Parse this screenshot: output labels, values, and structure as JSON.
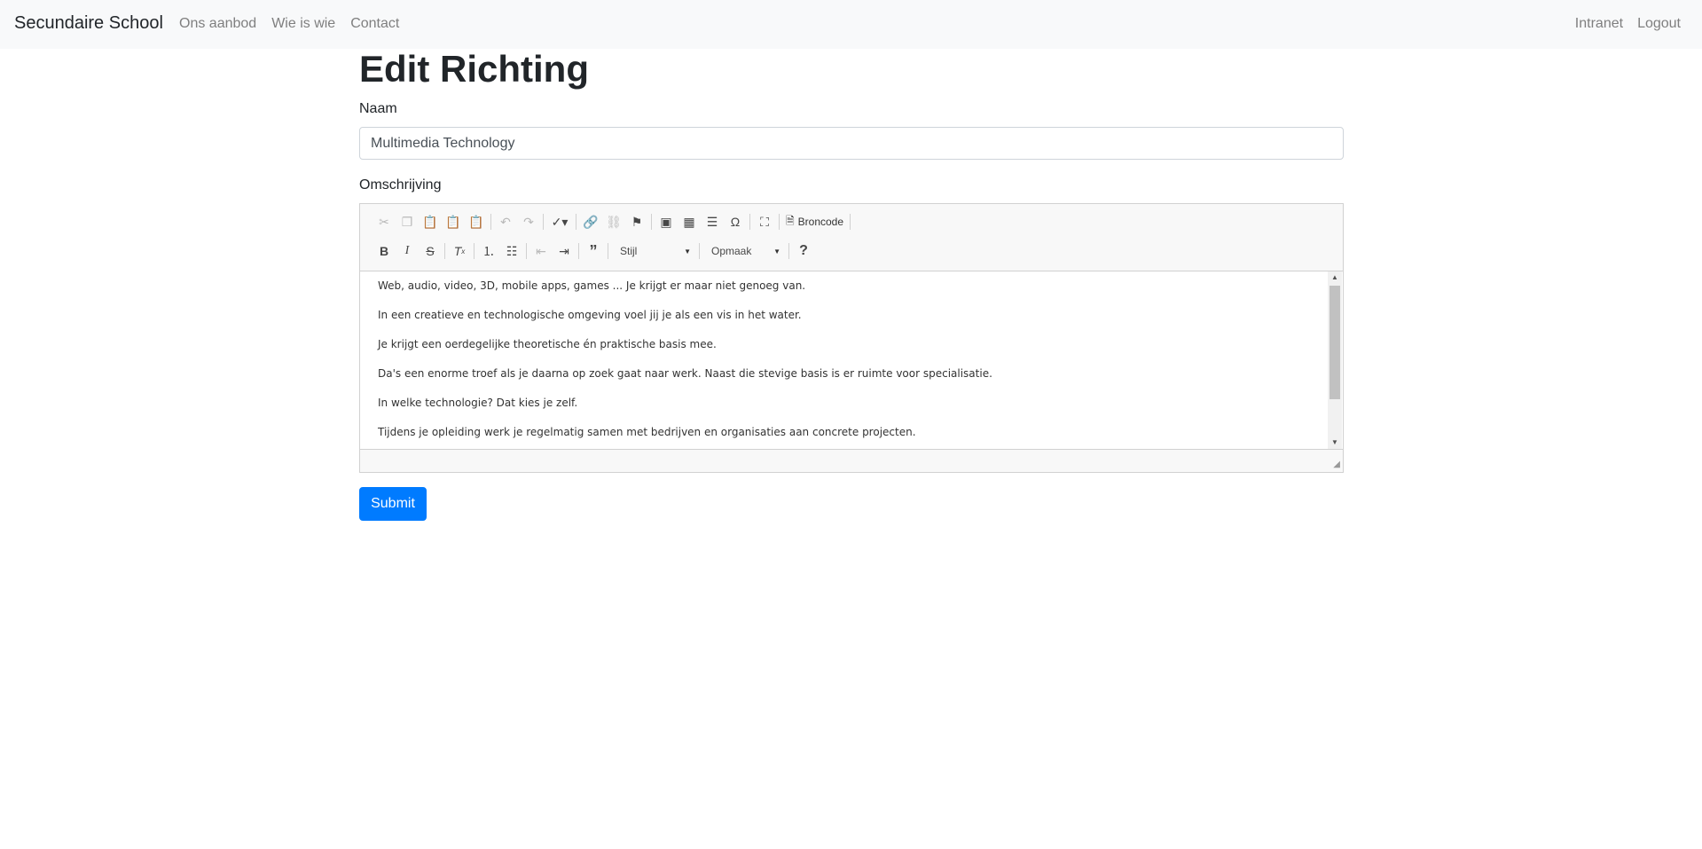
{
  "navbar": {
    "brand": "Secundaire School",
    "left_links": [
      "Ons aanbod",
      "Wie is wie",
      "Contact"
    ],
    "right_links": [
      "Intranet",
      "Logout"
    ]
  },
  "page": {
    "title": "Edit Richting"
  },
  "form": {
    "naam_label": "Naam",
    "naam_value": "Multimedia Technology",
    "omschrijving_label": "Omschrijving",
    "submit_label": "Submit"
  },
  "editor": {
    "source_button_label": "Broncode",
    "style_combo": "Stijl",
    "format_combo": "Opmaak",
    "content": [
      "Web, audio, video, 3D, mobile apps, games ... Je krijgt er maar niet genoeg van.",
      "In een creatieve en technologische omgeving voel jij je als een vis in het water.",
      "Je krijgt een oerdegelijke theoretische én praktische basis mee.",
      "Da's een enorme troef als je daarna op zoek gaat naar werk. Naast die stevige basis is er ruimte voor specialisatie.",
      "In welke technologie? Dat kies je zelf.",
      "Tijdens je opleiding werk je regelmatig samen met bedrijven en organisaties aan concrete projecten."
    ]
  }
}
